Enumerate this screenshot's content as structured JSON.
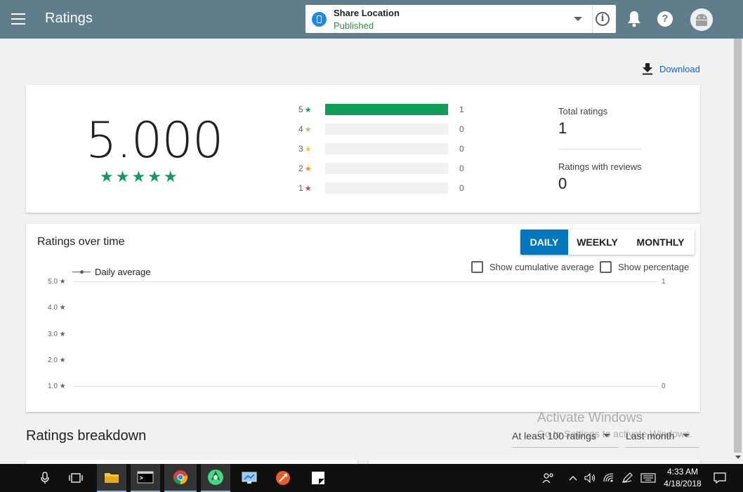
{
  "appbar": {
    "title": "Ratings",
    "app_name": "Share Location",
    "app_status": "Published",
    "info_glyph": "i",
    "help_glyph": "?"
  },
  "download_label": "Download",
  "summary": {
    "average": "5.000",
    "stars": "★★★★★",
    "distribution": [
      {
        "stars": "5",
        "count": "1",
        "fraction": 1.0,
        "color": "#0f9d58"
      },
      {
        "stars": "4",
        "count": "0",
        "fraction": 0,
        "color": "#9ccc65"
      },
      {
        "stars": "3",
        "count": "0",
        "fraction": 0,
        "color": "#fbc02d"
      },
      {
        "stars": "2",
        "count": "0",
        "fraction": 0,
        "color": "#fb8c00"
      },
      {
        "stars": "1",
        "count": "0",
        "fraction": 0,
        "color": "#e53935"
      }
    ],
    "star_glyph": "★",
    "total_ratings_label": "Total ratings",
    "total_ratings_value": "1",
    "reviews_label": "Ratings with reviews",
    "reviews_value": "0"
  },
  "over_time": {
    "title": "Ratings over time",
    "tabs": [
      "DAILY",
      "WEEKLY",
      "MONTHLY"
    ],
    "active_tab": "DAILY",
    "show_cumulative_label": "Show cumulative average",
    "show_percentage_label": "Show percentage",
    "legend_label": "Daily average",
    "y_left_ticks": [
      "5.0 ★",
      "4.0 ★",
      "3.0 ★",
      "2.0 ★",
      "1.0 ★"
    ],
    "y_right_ticks": [
      "1",
      "0"
    ]
  },
  "breakdown": {
    "title": "Ratings breakdown",
    "filter_min": "At least 100 ratings",
    "filter_period": "Last month"
  },
  "watermark": {
    "line1": "Activate Windows",
    "line2": "Go to Settings to activate Windows."
  },
  "taskbar": {
    "time": "4:33 AM",
    "date": "4/18/2018"
  },
  "colors": {
    "appbar": "#607d8b",
    "accent_blue": "#0277bd",
    "star_green": "#0f9d58",
    "published_green": "#388e3c"
  }
}
